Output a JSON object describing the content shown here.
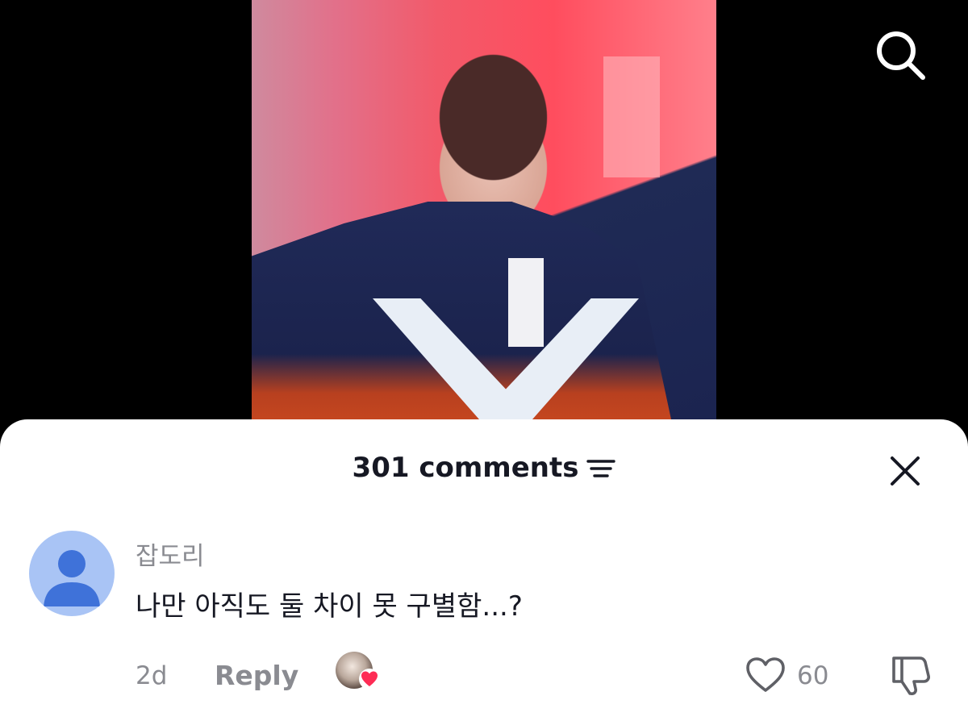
{
  "header": {
    "search_icon": "search-icon"
  },
  "sheet": {
    "comment_count_label": "301 comments",
    "sort_icon": "sort-lines-icon",
    "close_icon": "close-icon"
  },
  "comment": {
    "username": "잡도리",
    "text": "나만 아직도 둘 차이 못 구별함...?",
    "timestamp": "2d",
    "reply_label": "Reply",
    "like_count": "60",
    "avatar_icon": "default-user-icon",
    "creator_liked_icon": "heart-icon",
    "like_icon": "heart-outline-icon",
    "dislike_icon": "thumbs-down-icon"
  },
  "colors": {
    "text_primary": "#161823",
    "text_secondary": "#8a8b91",
    "avatar_bg": "#a9c4f5",
    "avatar_fg": "#3f72d9",
    "creator_heart": "#fe2c55"
  }
}
